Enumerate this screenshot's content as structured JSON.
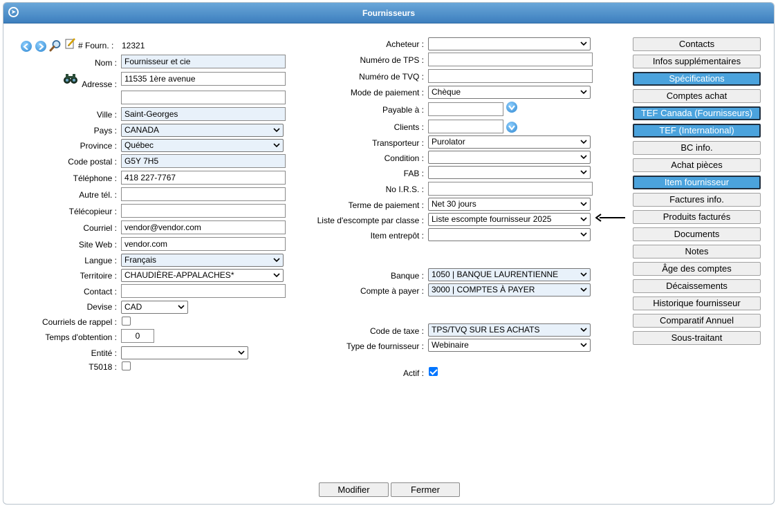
{
  "window": {
    "title": "Fournisseurs"
  },
  "left": {
    "fourn_label": "# Fourn. :",
    "fourn_value": "12321",
    "nom_label": "Nom :",
    "nom_value": "Fournisseur et cie",
    "adresse_label": "Adresse :",
    "adresse1_value": "11535 1ère avenue",
    "adresse2_value": "",
    "ville_label": "Ville :",
    "ville_value": "Saint-Georges",
    "pays_label": "Pays :",
    "pays_value": "CANADA",
    "province_label": "Province :",
    "province_value": "Québec",
    "code_postal_label": "Code postal :",
    "code_postal_value": "G5Y 7H5",
    "telephone_label": "Téléphone :",
    "telephone_value": "418 227-7767",
    "autre_tel_label": "Autre tél. :",
    "autre_tel_value": "",
    "telecopieur_label": "Télécopieur :",
    "telecopieur_value": "",
    "courriel_label": "Courriel :",
    "courriel_value": "vendor@vendor.com",
    "site_web_label": "Site Web :",
    "site_web_value": "vendor.com",
    "langue_label": "Langue :",
    "langue_value": "Français",
    "territoire_label": "Territoire :",
    "territoire_value": "CHAUDIÈRE-APPALACHES*",
    "contact_label": "Contact :",
    "contact_value": "",
    "devise_label": "Devise :",
    "devise_value": "CAD",
    "courriels_rappel_label": "Courriels de rappel :",
    "temps_obtention_label": "Temps d'obtention :",
    "temps_obtention_value": "0",
    "entite_label": "Entité :",
    "entite_value": "",
    "t5018_label": "T5018 :"
  },
  "middle": {
    "acheteur_label": "Acheteur :",
    "acheteur_value": "",
    "tps_label": "Numéro de TPS :",
    "tps_value": "",
    "tvq_label": "Numéro de TVQ :",
    "tvq_value": "",
    "mode_paiement_label": "Mode de paiement :",
    "mode_paiement_value": "Chèque",
    "payable_label": "Payable à :",
    "payable_value": "",
    "clients_label": "Clients :",
    "clients_value": "",
    "transporteur_label": "Transporteur :",
    "transporteur_value": "Purolator",
    "condition_label": "Condition :",
    "condition_value": "",
    "fab_label": "FAB :",
    "fab_value": "",
    "no_irs_label": "No I.R.S. :",
    "no_irs_value": "",
    "terme_label": "Terme de paiement :",
    "terme_value": "Net 30 jours",
    "liste_escompte_label": "Liste d'escompte par classe :",
    "liste_escompte_value": "Liste escompte fournisseur 2025",
    "item_entrepot_label": "Item entrepôt :",
    "item_entrepot_value": "",
    "banque_label": "Banque :",
    "banque_value": "1050 | BANQUE LAURENTIENNE",
    "compte_payer_label": "Compte à payer :",
    "compte_payer_value": "3000 | COMPTES À PAYER",
    "code_taxe_label": "Code de taxe :",
    "code_taxe_value": "TPS/TVQ SUR LES ACHATS",
    "type_fournisseur_label": "Type de fournisseur :",
    "type_fournisseur_value": "Webinaire",
    "actif_label": "Actif :"
  },
  "sidebar": {
    "items": [
      {
        "label": "Contacts"
      },
      {
        "label": "Infos supplémentaires"
      },
      {
        "label": "Spécifications"
      },
      {
        "label": "Comptes achat"
      },
      {
        "label": "TEF Canada (Fournisseurs)"
      },
      {
        "label": "TEF (International)"
      },
      {
        "label": "BC info."
      },
      {
        "label": "Achat pièces"
      },
      {
        "label": "Item fournisseur"
      },
      {
        "label": "Factures info."
      },
      {
        "label": "Produits facturés"
      },
      {
        "label": "Documents"
      },
      {
        "label": "Notes"
      },
      {
        "label": "Âge des comptes"
      },
      {
        "label": "Décaissements"
      },
      {
        "label": "Historique fournisseur"
      },
      {
        "label": "Comparatif Annuel"
      },
      {
        "label": "Sous-traitant"
      }
    ]
  },
  "footer": {
    "modifier_label": "Modifier",
    "fermer_label": "Fermer"
  },
  "colors": {
    "titlebar": "#3d7fbe",
    "active_button": "#4ba3dd",
    "highlight_input": "#e8f1fa"
  }
}
